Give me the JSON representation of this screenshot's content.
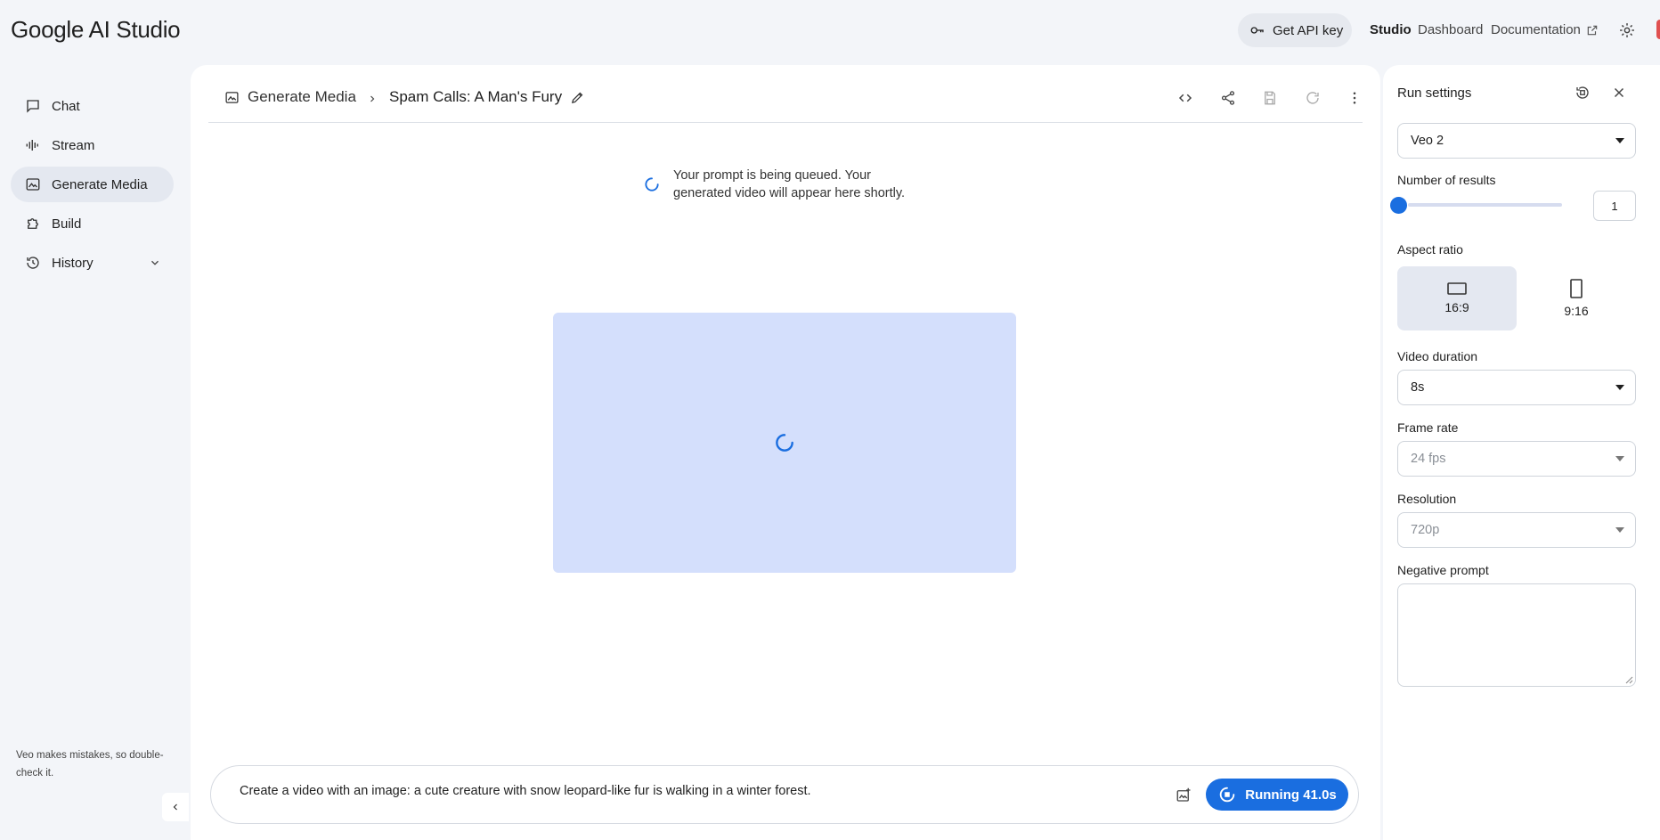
{
  "app": {
    "logo": "Google AI Studio"
  },
  "topbar": {
    "api_key": "Get API key",
    "nav": [
      "Studio",
      "Dashboard",
      "Documentation"
    ],
    "icons": [
      "key-icon",
      "external-link-icon",
      "gear-icon"
    ]
  },
  "sidebar": {
    "items": [
      {
        "label": "Chat",
        "icon": "chat-icon"
      },
      {
        "label": "Stream",
        "icon": "waveform-icon"
      },
      {
        "label": "Generate Media",
        "icon": "image-icon",
        "active": true
      },
      {
        "label": "Build",
        "icon": "puzzle-icon"
      },
      {
        "label": "History",
        "icon": "history-icon"
      }
    ],
    "disclaimer": "Veo makes mistakes, so double-check it."
  },
  "main": {
    "breadcrumb": {
      "section": "Generate Media",
      "title": "Spam Calls: A Man's Fury"
    },
    "queue_message": "Your prompt is being queued. Your generated video will appear here shortly.",
    "prompt": "Create a video with an image: a cute creature with snow leopard-like fur is walking in a winter forest.",
    "run_button": "Running 41.0s"
  },
  "settings": {
    "title": "Run settings",
    "model": "Veo 2",
    "results_label": "Number of results",
    "results_value": "1",
    "aspect_label": "Aspect ratio",
    "aspect_options": [
      {
        "label": "16:9",
        "active": true
      },
      {
        "label": "9:16",
        "active": false
      }
    ],
    "duration_label": "Video duration",
    "duration_value": "8s",
    "framerate_label": "Frame rate",
    "framerate_value": "24 fps",
    "resolution_label": "Resolution",
    "resolution_value": "720p",
    "negative_label": "Negative prompt",
    "negative_value": ""
  },
  "colors": {
    "accent": "#1a6ee0",
    "placeholder_video": "#d4dffc",
    "background": "#f3f5f9"
  }
}
